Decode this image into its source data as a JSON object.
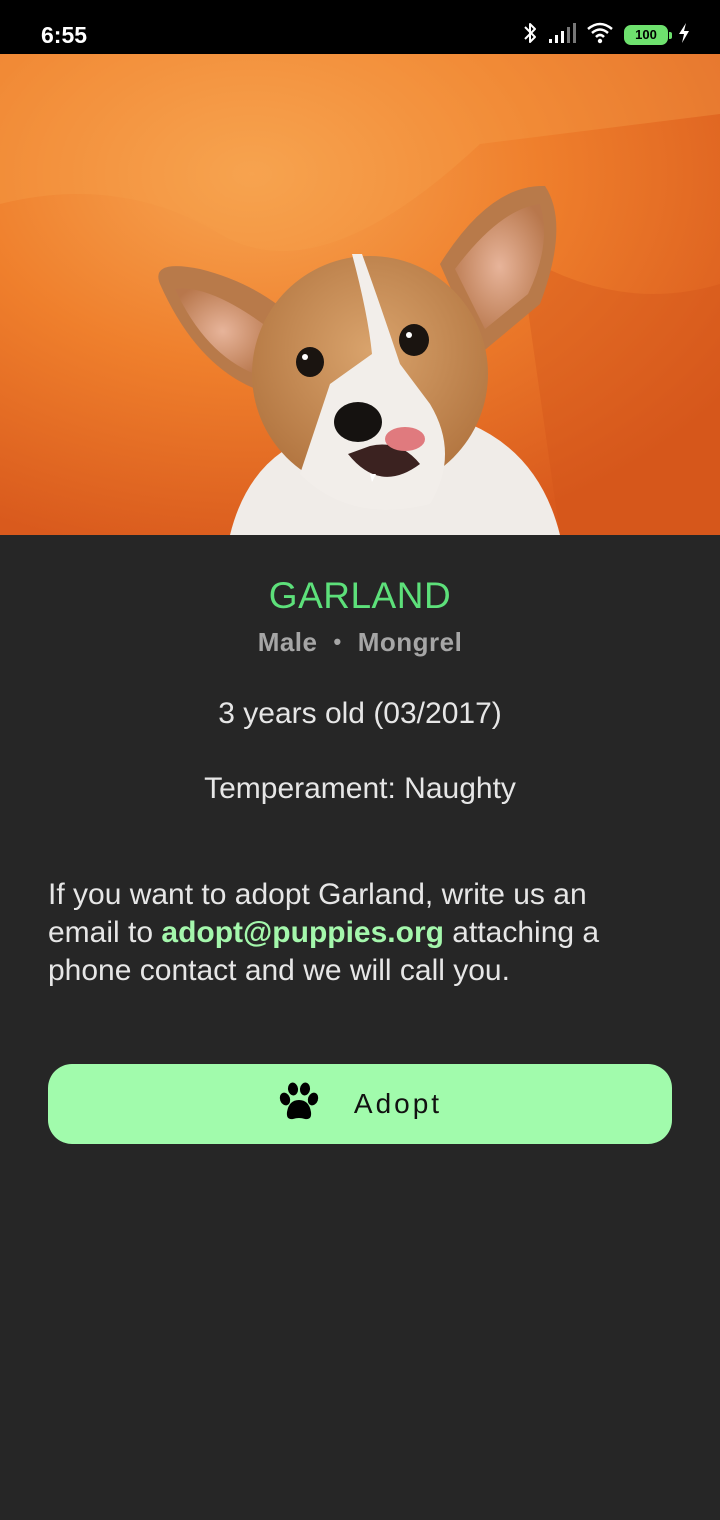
{
  "status_bar": {
    "time": "6:55",
    "battery_level": "100",
    "icons": [
      "bluetooth-icon",
      "signal-icon",
      "wifi-icon",
      "battery-icon",
      "charging-icon"
    ]
  },
  "pet": {
    "name": "GARLAND",
    "gender": "Male",
    "separator": "•",
    "breed": "Mongrel",
    "age": "3 years old (03/2017)",
    "temperament": "Temperament: Naughty"
  },
  "adoption": {
    "text_before": "If you want to adopt Garland, write us an email to ",
    "email": "adopt@puppies.org",
    "text_after": " attaching a phone contact and we will call you.",
    "button_label": "Adopt",
    "button_icon": "paw-icon"
  },
  "colors": {
    "background": "#262626",
    "accent_green": "#5de07a",
    "button_green": "#a1fbac",
    "link_green": "#a4f7ac",
    "hero_orange": "#f0832b"
  }
}
